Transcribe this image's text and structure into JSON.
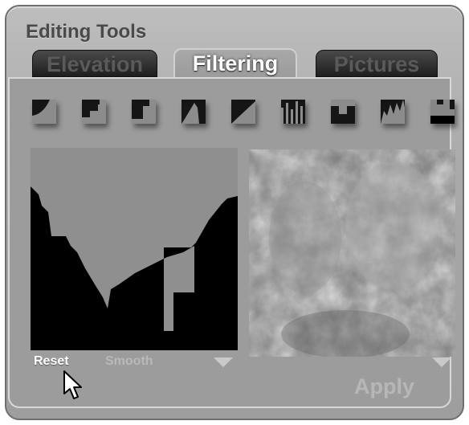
{
  "window": {
    "title": "Editing Tools"
  },
  "tabs": [
    {
      "label": "Elevation",
      "active": false
    },
    {
      "label": "Filtering",
      "active": true
    },
    {
      "label": "Pictures",
      "active": false
    }
  ],
  "filters": [
    {
      "icon": "curve-convex-icon"
    },
    {
      "icon": "steps-up-icon"
    },
    {
      "icon": "step-notch-icon"
    },
    {
      "icon": "peak-icon"
    },
    {
      "icon": "diagonal-ramp-icon"
    },
    {
      "icon": "comb-spikes-icon"
    },
    {
      "icon": "inverted-plateau-icon"
    },
    {
      "icon": "jagged-spikes-icon"
    },
    {
      "icon": "blocky-plateau-icon"
    }
  ],
  "controls": {
    "reset_label": "Reset",
    "smooth_label": "Smooth",
    "apply_label": "Apply"
  },
  "colors": {
    "panel": "#9c9c9c",
    "curve_fill": "#8f8f8f",
    "curve_bg": "#000000",
    "tab_inactive": "#1e1e1e",
    "tab_active_text": "#ffffff"
  }
}
